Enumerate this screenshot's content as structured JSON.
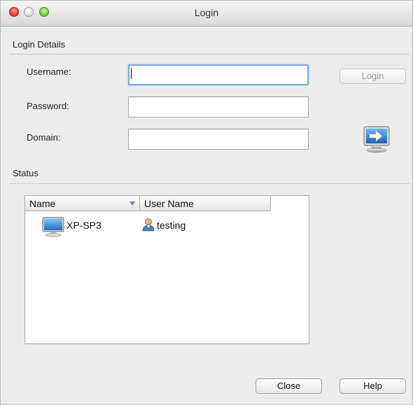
{
  "window": {
    "title": "Login"
  },
  "login_details": {
    "section_label": "Login Details",
    "username_label": "Username:",
    "password_label": "Password:",
    "domain_label": "Domain:",
    "username_value": "",
    "password_value": "",
    "domain_value": "",
    "login_button": "Login"
  },
  "status": {
    "section_label": "Status",
    "columns": [
      "Name",
      "User Name"
    ],
    "rows": [
      {
        "name": "XP-SP3",
        "user_name": "testing"
      }
    ]
  },
  "footer": {
    "close_button": "Close",
    "help_button": "Help"
  }
}
